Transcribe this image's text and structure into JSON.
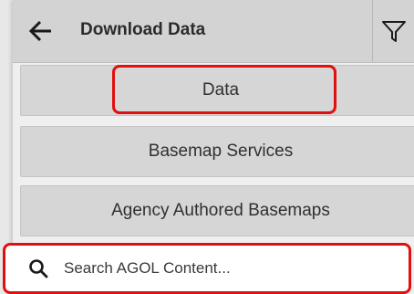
{
  "header": {
    "title": "Download Data",
    "back_icon": "arrow-left-icon",
    "filter_icon": "funnel-icon"
  },
  "menu": {
    "data_label": "Data",
    "basemap_label": "Basemap Services",
    "agency_label": "Agency Authored Basemaps"
  },
  "search": {
    "placeholder": "Search AGOL Content...",
    "value": "",
    "icon": "search-icon"
  },
  "colors": {
    "highlight": "#e01010",
    "header_bg": "#d3d3d3",
    "button_bg": "#d6d6d6"
  }
}
